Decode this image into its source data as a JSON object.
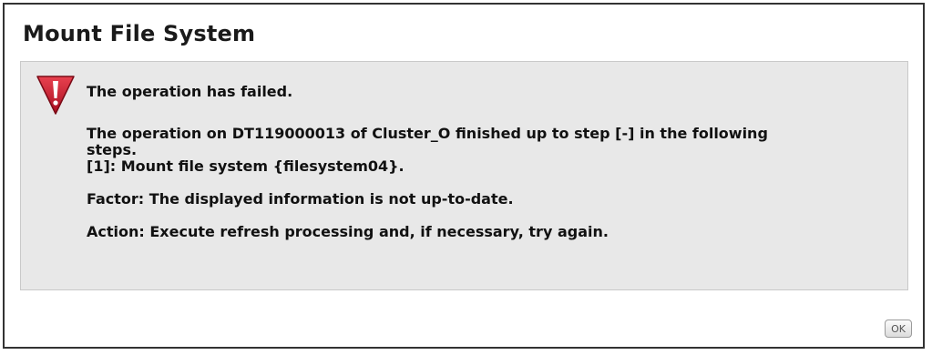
{
  "dialog": {
    "title": "Mount File System",
    "icon": "error-warning-icon",
    "message": {
      "headline": "The operation has failed.",
      "detail_line1": "The operation on DT119000013 of Cluster_O finished up to step [-] in the following",
      "detail_line2": "steps.",
      "step_line": "[1]: Mount file system {filesystem04}.",
      "factor": "Factor: The displayed information is not up-to-date.",
      "action": "Action: Execute refresh processing and, if necessary, try again."
    },
    "ok_label": "OK"
  },
  "colors": {
    "icon_red": "#c8102e",
    "panel_background": "#e8e8e8",
    "border": "#333333"
  }
}
